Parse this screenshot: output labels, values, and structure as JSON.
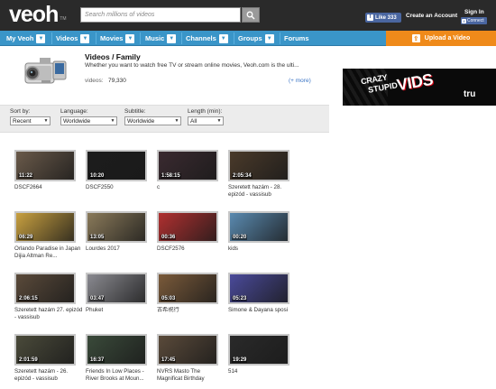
{
  "header": {
    "logo": "veoh",
    "logo_tm": "TM",
    "search_placeholder": "Search millions of videos",
    "like_label": "Like 333",
    "create_account": "Create an Account",
    "sign_in": "Sign In",
    "connect": "Connect"
  },
  "nav": {
    "items": [
      {
        "label": "My Veoh"
      },
      {
        "label": "Videos"
      },
      {
        "label": "Movies"
      },
      {
        "label": "Music"
      },
      {
        "label": "Channels"
      },
      {
        "label": "Groups"
      },
      {
        "label": "Forums"
      }
    ],
    "upload": "Upload a Video"
  },
  "category": {
    "title": "Videos / Family",
    "description": "Whether you want to watch free TV or stream online movies, Veoh.com is the ulti...",
    "videos_label": "videos:",
    "videos_count": "79,330",
    "more": "(+ more)"
  },
  "ad": {
    "crazy": "CRAZY",
    "stupid": "STUPID",
    "vids": "VIDS",
    "network": "tru"
  },
  "filters": {
    "sort_label": "Sort by:",
    "sort_value": "Recent",
    "language_label": "Language:",
    "language_value": "Worldwide",
    "subtitle_label": "Subtitle:",
    "subtitle_value": "Worldwide",
    "length_label": "Length (min):",
    "length_value": "All"
  },
  "videos": [
    {
      "duration": "11:22",
      "title": "DSCF2664",
      "color": "#6a5a4a"
    },
    {
      "duration": "10:20",
      "title": "DSCF2550",
      "color": "#1c1c1c"
    },
    {
      "duration": "1:58:15",
      "title": "c",
      "color": "#3a2a30"
    },
    {
      "duration": "2:05:34",
      "title": "Szeretett hazám - 28. epizód - vassisub",
      "color": "#4a3a2a"
    },
    {
      "duration": "06:29",
      "title": "Orlando Paradise in Japan Dijia Altman Re...",
      "color": "#c8a040"
    },
    {
      "duration": "13:05",
      "title": "Lourdes 2017",
      "color": "#8a7a5a"
    },
    {
      "duration": "00:36",
      "title": "DSCF2576",
      "color": "#b03030"
    },
    {
      "duration": "00:20",
      "title": "kids",
      "color": "#5a8ab0"
    },
    {
      "duration": "2:06:15",
      "title": "Szeretett hazám 27. epizód - vassisub",
      "color": "#5a4a3a"
    },
    {
      "duration": "03:47",
      "title": "Phuket",
      "color": "#8a8a90"
    },
    {
      "duration": "05:03",
      "title": "古希祝行",
      "color": "#7a5a3a"
    },
    {
      "duration": "05:23",
      "title": "Simone & Dayana sposi",
      "color": "#4a4a9a"
    },
    {
      "duration": "2:01:59",
      "title": "Szeretett hazám - 26. epizód - vassisub",
      "color": "#4a4a3a"
    },
    {
      "duration": "16:37",
      "title": "Friends In Low Places - River Brooks at Moun...",
      "color": "#3a4a3a"
    },
    {
      "duration": "17:45",
      "title": "NVRS Masto The Magnificat Birthday",
      "color": "#5a4a3a"
    },
    {
      "duration": "19:29",
      "title": "514",
      "color": "#2a2a2a"
    }
  ]
}
